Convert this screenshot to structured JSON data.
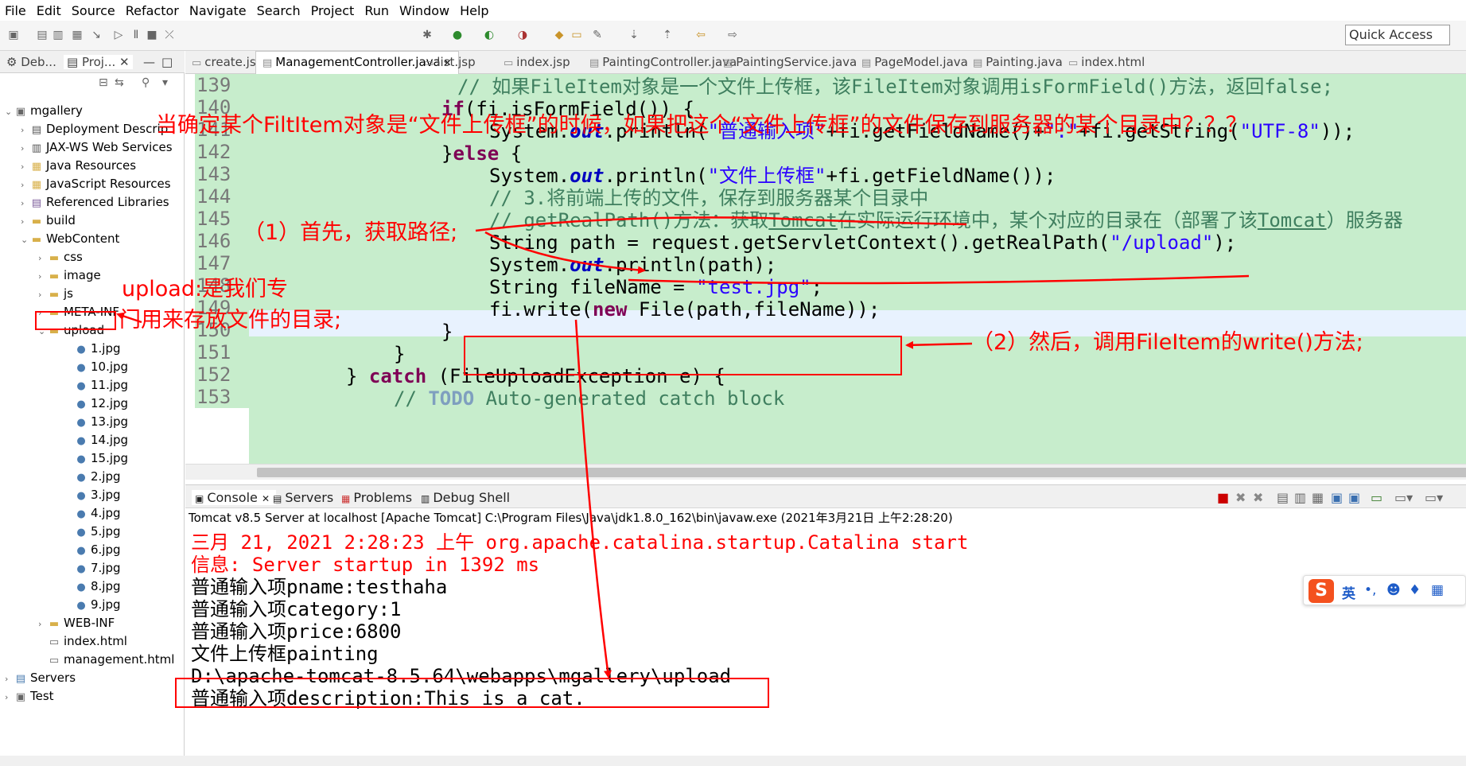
{
  "menu": [
    "File",
    "Edit",
    "Source",
    "Refactor",
    "Navigate",
    "Search",
    "Project",
    "Run",
    "Window",
    "Help"
  ],
  "toolbar": {
    "quick_access": "Quick Access"
  },
  "left_panel": {
    "tabs": [
      "Deb...",
      "Proj..."
    ],
    "tree": [
      {
        "label": "mgallery",
        "depth": 0,
        "icon": "project-icon",
        "expanded": true
      },
      {
        "label": "Deployment Descrip",
        "depth": 1,
        "icon": "deployment-icon"
      },
      {
        "label": "JAX-WS Web Services",
        "depth": 1,
        "icon": "webservice-icon"
      },
      {
        "label": "Java Resources",
        "depth": 1,
        "icon": "java-resources-icon"
      },
      {
        "label": "JavaScript Resources",
        "depth": 1,
        "icon": "js-resources-icon"
      },
      {
        "label": "Referenced Libraries",
        "depth": 1,
        "icon": "library-icon"
      },
      {
        "label": "build",
        "depth": 1,
        "icon": "folder-icon"
      },
      {
        "label": "WebContent",
        "depth": 1,
        "icon": "folder-icon",
        "expanded": true
      },
      {
        "label": "css",
        "depth": 2,
        "icon": "folder-icon"
      },
      {
        "label": "image",
        "depth": 2,
        "icon": "folder-icon"
      },
      {
        "label": "js",
        "depth": 2,
        "icon": "folder-icon"
      },
      {
        "label": "META-INF",
        "depth": 2,
        "icon": "folder-icon"
      },
      {
        "label": "upload",
        "depth": 2,
        "icon": "folder-icon",
        "expanded": true
      },
      {
        "label": "1.jpg",
        "depth": 3,
        "icon": "image-file-icon"
      },
      {
        "label": "10.jpg",
        "depth": 3,
        "icon": "image-file-icon"
      },
      {
        "label": "11.jpg",
        "depth": 3,
        "icon": "image-file-icon"
      },
      {
        "label": "12.jpg",
        "depth": 3,
        "icon": "image-file-icon"
      },
      {
        "label": "13.jpg",
        "depth": 3,
        "icon": "image-file-icon"
      },
      {
        "label": "14.jpg",
        "depth": 3,
        "icon": "image-file-icon"
      },
      {
        "label": "15.jpg",
        "depth": 3,
        "icon": "image-file-icon"
      },
      {
        "label": "2.jpg",
        "depth": 3,
        "icon": "image-file-icon"
      },
      {
        "label": "3.jpg",
        "depth": 3,
        "icon": "image-file-icon"
      },
      {
        "label": "4.jpg",
        "depth": 3,
        "icon": "image-file-icon"
      },
      {
        "label": "5.jpg",
        "depth": 3,
        "icon": "image-file-icon"
      },
      {
        "label": "6.jpg",
        "depth": 3,
        "icon": "image-file-icon"
      },
      {
        "label": "7.jpg",
        "depth": 3,
        "icon": "image-file-icon"
      },
      {
        "label": "8.jpg",
        "depth": 3,
        "icon": "image-file-icon"
      },
      {
        "label": "9.jpg",
        "depth": 3,
        "icon": "image-file-icon"
      },
      {
        "label": "WEB-INF",
        "depth": 2,
        "icon": "folder-icon"
      },
      {
        "label": "index.html",
        "depth": 2,
        "icon": "html-file-icon"
      },
      {
        "label": "management.html",
        "depth": 2,
        "icon": "html-file-icon"
      },
      {
        "label": "Servers",
        "depth": 0,
        "icon": "servers-icon"
      },
      {
        "label": "Test",
        "depth": 0,
        "icon": "project-icon"
      }
    ]
  },
  "editor": {
    "tabs": [
      "create.jsp",
      "ManagementController.java",
      "list.jsp",
      "index.jsp",
      "PaintingController.java",
      "PaintingService.java",
      "PageModel.java",
      "Painting.java",
      "index.html"
    ],
    "active_tab": "ManagementController.java",
    "line_numbers": [
      "139",
      "140",
      "141",
      "142",
      "143",
      "144",
      "145",
      "146",
      "147",
      "148",
      "149",
      "150",
      "151",
      "152",
      "153"
    ],
    "code": {
      "l139": "// 如果FileItem对象是一个文件上传框，该FileItem对象调用isFormField()方法，返回false;",
      "l140a": "if",
      "l140b": "(fi.isFormField()) {",
      "l141a": "System.",
      "l141b": "out",
      "l141c": ".println(",
      "l141d": "\"普通输入项\"",
      "l141e": "+fi.getFieldName()+",
      "l141f": "\":\"",
      "l141g": "+fi.getString(",
      "l141h": "\"UTF-8\"",
      "l141i": "));",
      "l142a": "}",
      "l142b": "else",
      "l142c": " {",
      "l143a": "System.",
      "l143b": "out",
      "l143c": ".println(",
      "l143d": "\"文件上传框\"",
      "l143e": "+fi.getFieldName());",
      "l144": "// 3.将前端上传的文件，保存到服务器某个目录中",
      "l145a": "// getRealPath()方法：获取",
      "l145b": "Tomcat",
      "l145c": "在实际运行环境中，某个对应的目录在（部署了该",
      "l145d": "Tomcat",
      "l145e": "）服务器",
      "l146a": "String path = request.getServletContext().getRealPath(",
      "l146b": "\"/upload\"",
      "l146c": ");",
      "l147a": "System.",
      "l147b": "out",
      "l147c": ".println(path);",
      "l148a": "String fileName = ",
      "l148b": "\"test.jpg\"",
      "l148c": ";",
      "l149a": "fi.write(",
      "l149b": "new",
      "l149c": " File(path,fileName));",
      "l150": "}",
      "l151": "}",
      "l152a": "} ",
      "l152b": "catch",
      "l152c": " (FileUploadException e) {",
      "l153a": "// ",
      "l153b": "TODO",
      "l153c": " Auto-generated catch block"
    }
  },
  "console": {
    "tabs": [
      "Console",
      "Servers",
      "Problems",
      "Debug Shell"
    ],
    "status": "Tomcat v8.5 Server at localhost [Apache Tomcat] C:\\Program Files\\Java\\jdk1.8.0_162\\bin\\javaw.exe (2021年3月21日 上午2:28:20)",
    "lines": [
      {
        "text": "三月 21, 2021 2:28:23 上午 org.apache.catalina.startup.Catalina start",
        "color": "#ff0000"
      },
      {
        "text": "信息: Server startup in 1392 ms",
        "color": "#ff0000"
      },
      {
        "text": "普通输入项pname:testhaha",
        "color": "#000000"
      },
      {
        "text": "普通输入项category:1",
        "color": "#000000"
      },
      {
        "text": "普通输入项price:6800",
        "color": "#000000"
      },
      {
        "text": "文件上传框painting",
        "color": "#000000"
      },
      {
        "text": "D:\\apache-tomcat-8.5.64\\webapps\\mgallery\\upload",
        "color": "#000000"
      },
      {
        "text": "普通输入项description:This is a cat.",
        "color": "#000000"
      }
    ]
  },
  "annotations": {
    "top_question": "当确定某个FiltItem对象是“文件上传框”的时候，如果把这个“文件上传框”的文件保存到服务器的某个目录中？？？",
    "step1": "（1）首先，获取路径;",
    "step2": "（2）然后，调用FileItem的write()方法;",
    "upload_note_1": "upload:是我们专",
    "upload_note_2": "门用来存放文件的目录;"
  },
  "ime": {
    "label": "英",
    "logo": "S"
  },
  "colors": {
    "annotation": "#ff0000",
    "code_bg": "#c7edcc",
    "keyword": "#7f0055",
    "string": "#2a00ff",
    "comment": "#3f7f5f"
  }
}
